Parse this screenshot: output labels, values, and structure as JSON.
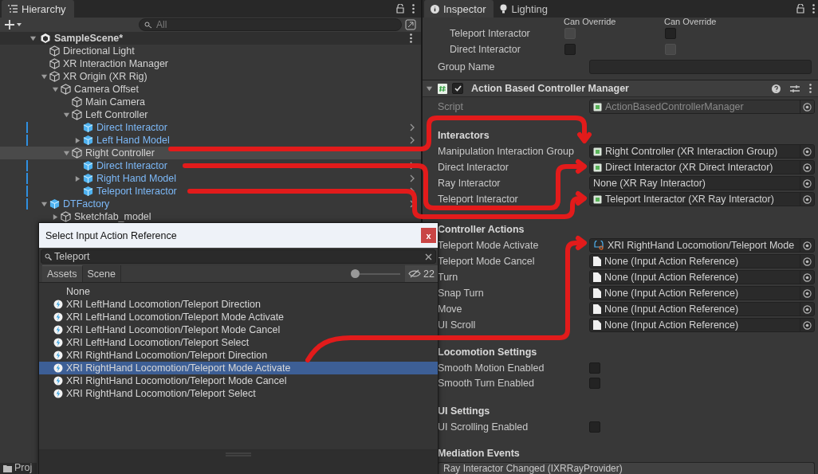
{
  "hierarchy": {
    "tab": "Hierarchy",
    "search": {
      "placeholder": "All"
    },
    "scene": {
      "name": "SampleScene*",
      "expanded": true
    },
    "items": [
      {
        "name": "Directional Light",
        "kind": "object",
        "selected": false
      },
      {
        "name": "XR Interaction Manager",
        "kind": "object",
        "selected": false
      },
      {
        "name": "XR Origin (XR Rig)",
        "kind": "object",
        "selected": false,
        "expanded": true,
        "children": [
          {
            "name": "Camera Offset",
            "kind": "object",
            "selected": false,
            "expanded": true,
            "children": [
              {
                "name": "Main Camera",
                "kind": "object",
                "selected": false
              },
              {
                "name": "Left Controller",
                "kind": "object",
                "selected": false,
                "expanded": true,
                "children": [
                  {
                    "name": "Direct Interactor",
                    "kind": "prefab",
                    "selected": false
                  },
                  {
                    "name": "Left Hand Model",
                    "kind": "prefab",
                    "selected": false,
                    "expanded": false
                  }
                ]
              },
              {
                "name": "Right Controller",
                "kind": "object",
                "selected": true,
                "expanded": true,
                "children": [
                  {
                    "name": "Direct Interactor",
                    "kind": "prefab",
                    "selected": false
                  },
                  {
                    "name": "Right Hand Model",
                    "kind": "prefab",
                    "selected": false,
                    "expanded": false
                  },
                  {
                    "name": "Teleport Interactor",
                    "kind": "prefab",
                    "selected": false
                  }
                ]
              }
            ]
          }
        ]
      },
      {
        "name": "DTFactory",
        "kind": "prefab",
        "selected": false,
        "expanded": true,
        "children": [
          {
            "name": "Sketchfab_model",
            "kind": "object",
            "selected": false,
            "expanded": false
          }
        ]
      }
    ],
    "bottom_tab": "Proj"
  },
  "picker": {
    "title": "Select Input Action Reference",
    "close": "x",
    "search": "Teleport",
    "tabs": [
      {
        "label": "Assets",
        "selected": true
      },
      {
        "label": "Scene",
        "selected": false
      }
    ],
    "zoom": {
      "level": 0.05
    },
    "hidden_count": "22",
    "items": [
      {
        "label": "None",
        "kind": "none",
        "selected": false
      },
      {
        "label": "XRI LeftHand Locomotion/Teleport Direction",
        "kind": "action",
        "selected": false
      },
      {
        "label": "XRI LeftHand Locomotion/Teleport Mode Activate",
        "kind": "action",
        "selected": false
      },
      {
        "label": "XRI LeftHand Locomotion/Teleport Mode Cancel",
        "kind": "action",
        "selected": false
      },
      {
        "label": "XRI LeftHand Locomotion/Teleport Select",
        "kind": "action",
        "selected": false
      },
      {
        "label": "XRI RightHand Locomotion/Teleport Direction",
        "kind": "action",
        "selected": false
      },
      {
        "label": "XRI RightHand Locomotion/Teleport Mode Activate",
        "kind": "action",
        "selected": true
      },
      {
        "label": "XRI RightHand Locomotion/Teleport Mode Cancel",
        "kind": "action",
        "selected": false
      },
      {
        "label": "XRI RightHand Locomotion/Teleport Select",
        "kind": "action",
        "selected": false
      }
    ]
  },
  "inspector": {
    "tabs": [
      {
        "label": "Inspector",
        "selected": true
      },
      {
        "label": "Lighting",
        "selected": false
      }
    ],
    "override": {
      "headers": [
        "Can Override",
        "Can Override"
      ],
      "rows": [
        {
          "label": "Teleport Interactor",
          "checks": [
            {
              "checked": false,
              "disabled": true
            },
            {
              "checked": false,
              "disabled": false
            }
          ]
        },
        {
          "label": "Direct Interactor",
          "checks": [
            {
              "checked": false,
              "disabled": false
            },
            {
              "checked": false,
              "disabled": true
            }
          ]
        }
      ]
    },
    "group_name": {
      "label": "Group Name"
    },
    "component": {
      "title": "Action Based Controller Manager",
      "enabled": true,
      "expanded": true,
      "script_label": "Script",
      "script": "ActionBasedControllerManager"
    },
    "sections": [
      {
        "heading": "Interactors",
        "fields": [
          {
            "label": "Manipulation Interaction Group",
            "kind": "object-ref",
            "value": "Right Controller (XR Interaction Group)"
          },
          {
            "label": "Direct Interactor",
            "kind": "object-ref",
            "value": "Direct Interactor (XR Direct Interactor)"
          },
          {
            "label": "Ray Interactor",
            "kind": "empty-ref",
            "value": "None (XR Ray Interactor)"
          },
          {
            "label": "Teleport Interactor",
            "kind": "object-ref",
            "value": "Teleport Interactor (XR Ray Interactor)"
          }
        ]
      },
      {
        "heading": "Controller Actions",
        "fields": [
          {
            "label": "Teleport Mode Activate",
            "kind": "action-ref",
            "value": "XRI RightHand Locomotion/Teleport Mode"
          },
          {
            "label": "Teleport Mode Cancel",
            "kind": "asset-ref",
            "value": "None (Input Action Reference)"
          },
          {
            "label": "Turn",
            "kind": "asset-ref",
            "value": "None (Input Action Reference)"
          },
          {
            "label": "Snap Turn",
            "kind": "asset-ref",
            "value": "None (Input Action Reference)"
          },
          {
            "label": "Move",
            "kind": "asset-ref",
            "value": "None (Input Action Reference)"
          },
          {
            "label": "UI Scroll",
            "kind": "asset-ref",
            "value": "None (Input Action Reference)"
          }
        ]
      },
      {
        "heading": "Locomotion Settings",
        "fields": [
          {
            "label": "Smooth Motion Enabled",
            "kind": "checkbox",
            "checked": false
          },
          {
            "label": "Smooth Turn Enabled",
            "kind": "checkbox",
            "checked": false
          }
        ]
      },
      {
        "heading": "UI Settings",
        "fields": [
          {
            "label": "UI Scrolling Enabled",
            "kind": "checkbox",
            "checked": false
          }
        ]
      },
      {
        "heading": "Mediation Events",
        "fields": [
          {
            "kind": "event",
            "value": "Ray Interactor Changed (IXRRayProvider)"
          }
        ]
      }
    ]
  }
}
